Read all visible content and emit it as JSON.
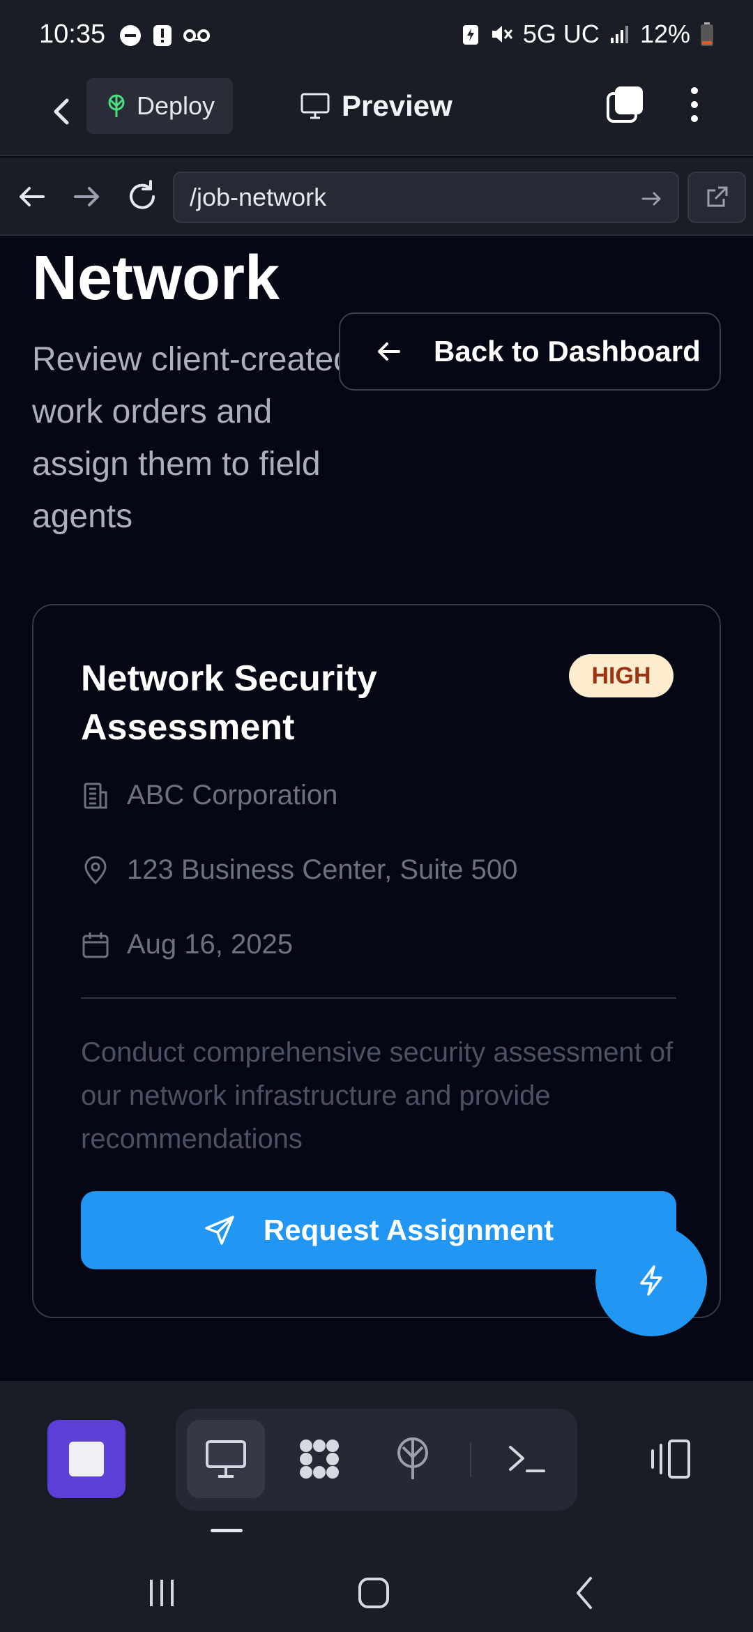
{
  "status_bar": {
    "time": "10:35",
    "network": "5G UC",
    "battery": "12%"
  },
  "app_header": {
    "deploy_label": "Deploy",
    "preview_label": "Preview"
  },
  "browser": {
    "url": "/job-network"
  },
  "page": {
    "title": "Network",
    "subtitle": "Review client-created work orders and assign them to field agents",
    "back_button_label": "Back to Dashboard"
  },
  "job": {
    "title": "Network Security Assessment",
    "priority": "HIGH",
    "company": "ABC Corporation",
    "address": "123 Business Center, Suite 500",
    "date": "Aug 16, 2025",
    "description": "Conduct comprehensive security assessment of our network infrastructure and provide recommendations",
    "request_button_label": "Request Assignment"
  },
  "colors": {
    "accent_blue": "#2196f3",
    "stop_purple": "#5b3fd6",
    "badge_bg": "#feeccf",
    "badge_text": "#9a3412"
  },
  "icons": [
    "back-icon",
    "deploy-tree-icon",
    "monitor-icon",
    "tabs-icon",
    "more-vert-icon",
    "arrow-left-icon",
    "arrow-right-icon",
    "reload-icon",
    "go-icon",
    "external-link-icon",
    "building-icon",
    "location-pin-icon",
    "calendar-icon",
    "send-icon",
    "bolt-icon",
    "stop-icon",
    "desktop-icon",
    "apps-icon",
    "deploy-icon",
    "terminal-icon",
    "panel-icon",
    "recents-icon",
    "home-icon",
    "system-back-icon"
  ]
}
